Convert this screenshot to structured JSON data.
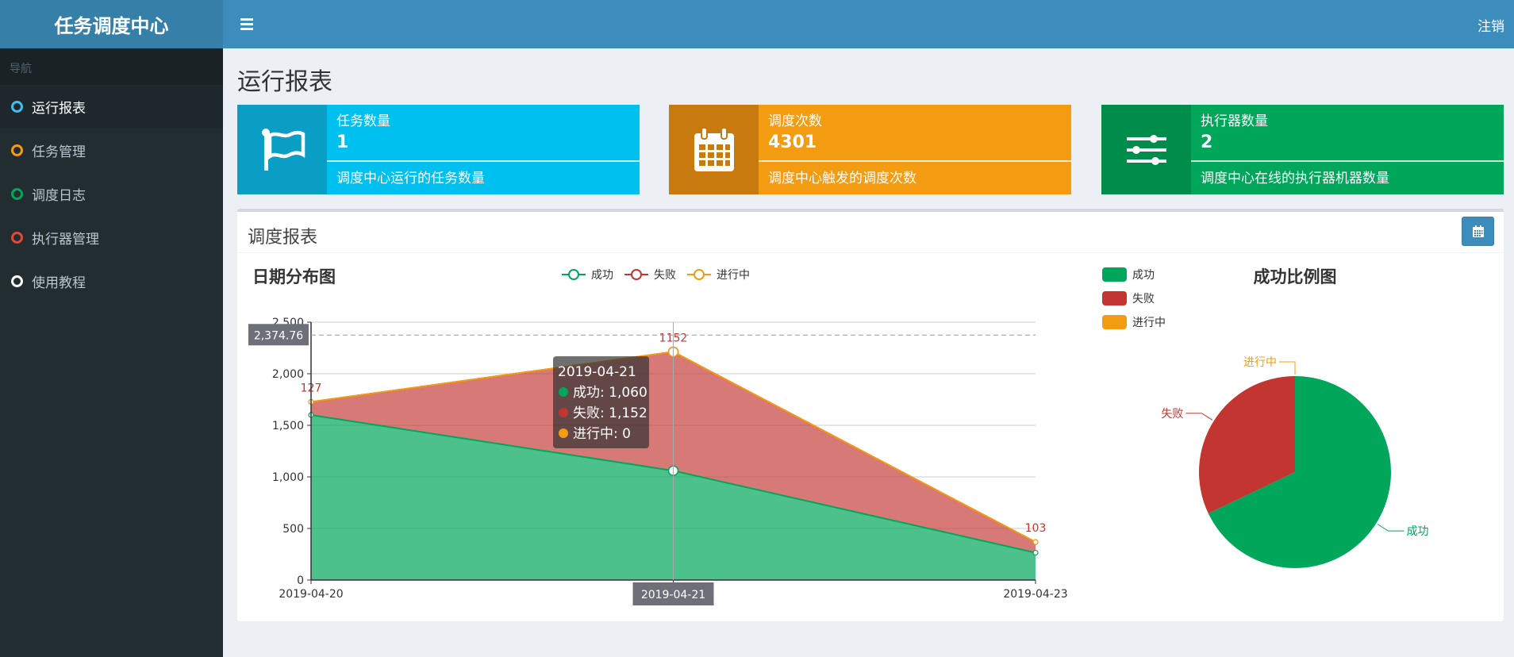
{
  "app": {
    "title": "任务调度中心",
    "logout": "注销"
  },
  "sidebar": {
    "header": "导航",
    "items": [
      {
        "label": "运行报表",
        "color": "#3fbfef",
        "active": true
      },
      {
        "label": "任务管理",
        "color": "#f39c12"
      },
      {
        "label": "调度日志",
        "color": "#00a65a"
      },
      {
        "label": "执行器管理",
        "color": "#dd4b39"
      },
      {
        "label": "使用教程",
        "color": "#ffffff"
      }
    ]
  },
  "page": {
    "title": "运行报表"
  },
  "info_boxes": [
    {
      "label": "任务数量",
      "number": "1",
      "desc": "调度中心运行的任务数量",
      "icon": "flag-icon",
      "color": "#00c0ef",
      "icon_bg": "#0b9ec5"
    },
    {
      "label": "调度次数",
      "number": "4301",
      "desc": "调度中心触发的调度次数",
      "icon": "calendar-icon",
      "color": "#f39c12",
      "icon_bg": "#c87a0e"
    },
    {
      "label": "执行器数量",
      "number": "2",
      "desc": "调度中心在线的执行器机器数量",
      "icon": "sliders-icon",
      "color": "#00a65a",
      "icon_bg": "#008d4c"
    }
  ],
  "report": {
    "title": "调度报表",
    "calendar_icon": "calendar-icon"
  },
  "chart_data": [
    {
      "type": "area",
      "title": "日期分布图",
      "x": [
        "2019-04-20",
        "2019-04-21",
        "2019-04-23"
      ],
      "ylim": [
        0,
        2500
      ],
      "yticks": [
        "0",
        "500",
        "1,000",
        "1,500",
        "2,000",
        "2,500"
      ],
      "stacked": true,
      "series": [
        {
          "name": "成功",
          "values": [
            1600,
            1060,
            265
          ],
          "color": "#00a65a"
        },
        {
          "name": "失败",
          "values": [
            127,
            1152,
            103
          ],
          "color": "#c23531"
        },
        {
          "name": "进行中",
          "values": [
            0,
            0,
            0
          ],
          "color": "#f39c12"
        }
      ],
      "data_labels": [
        "127",
        "1152",
        "103"
      ],
      "legend": "top-center",
      "grid": true,
      "crosshair": {
        "y_label": "2,374.76",
        "y_value": 2374.76,
        "x_label": "2019-04-21"
      },
      "tooltip": {
        "title": "2019-04-21",
        "lines": [
          "成功: 1,060",
          "失败: 1,152",
          "进行中: 0"
        ]
      }
    },
    {
      "type": "pie",
      "title": "成功比例图",
      "categories": [
        "成功",
        "失败",
        "进行中"
      ],
      "values": [
        2925,
        1382,
        0
      ],
      "colors": [
        "#00a65a",
        "#c23531",
        "#f39c12"
      ],
      "legend": "top-left"
    }
  ]
}
